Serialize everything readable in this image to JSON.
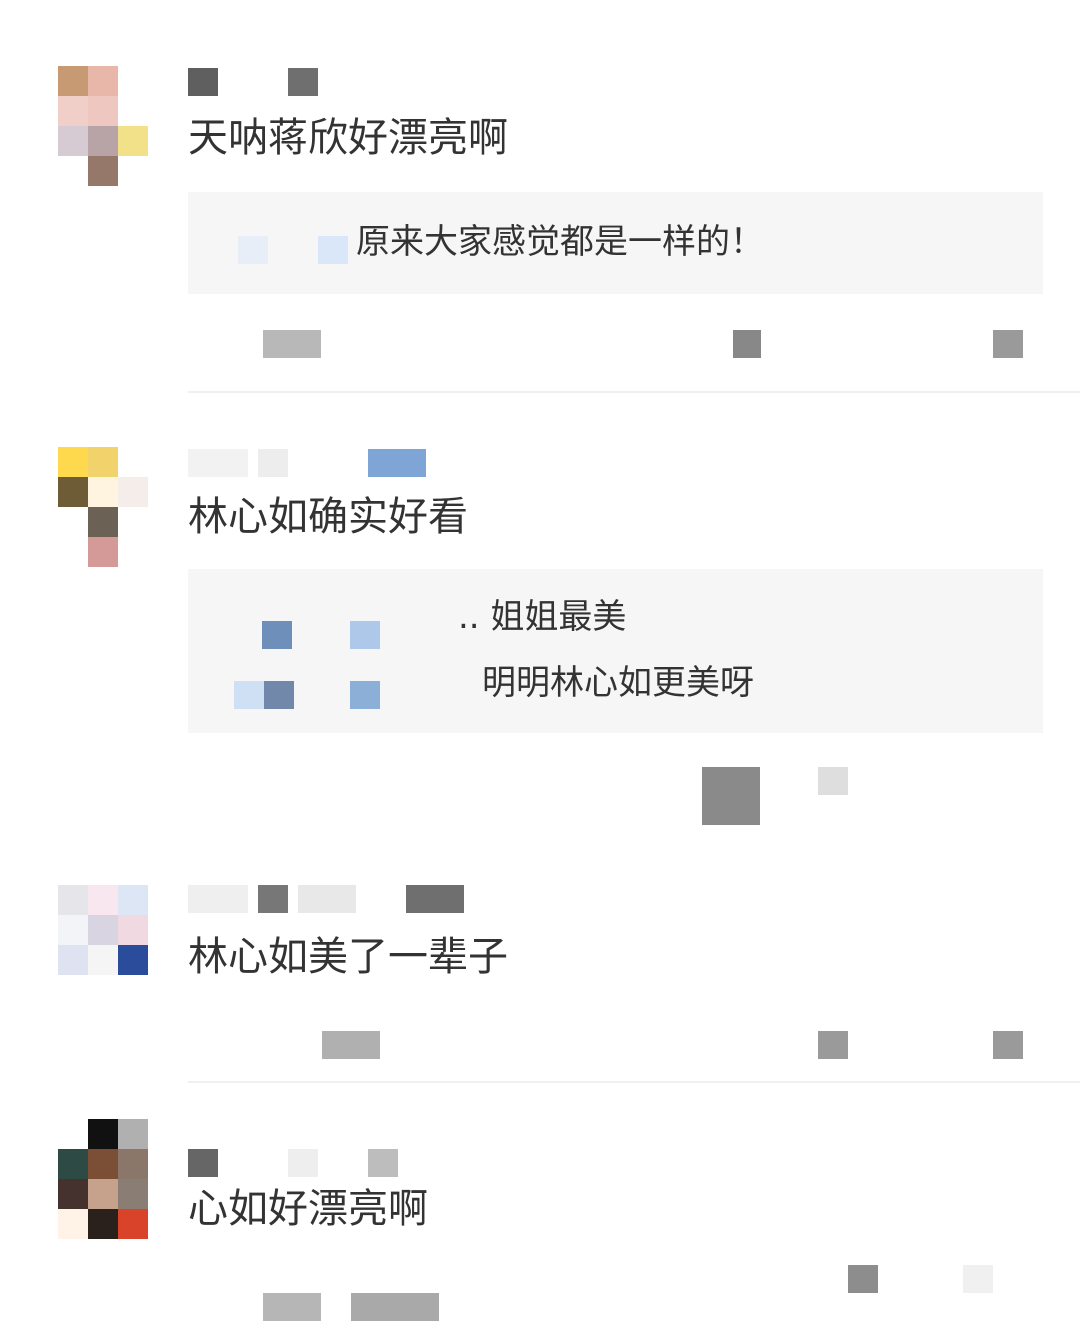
{
  "comments": [
    {
      "text": "天呐蒋欣好漂亮啊",
      "reply": {
        "text": "原来大家感觉都是一样的！"
      }
    },
    {
      "text": "林心如确实好看",
      "replies": [
        {
          "text": ".. 姐姐最美"
        },
        {
          "text": "明明林心如更美呀"
        }
      ]
    },
    {
      "text": "林心如美了一辈子"
    },
    {
      "text": "心如好漂亮啊"
    }
  ],
  "colors": {
    "background": "#ffffff",
    "text": "#333333",
    "reply_bg": "#f6f6f6",
    "blurred_gray": "#6f6f6f",
    "blurred_light_gray": "#c9c9c9",
    "blurred_blue": "#7fa4d6"
  }
}
